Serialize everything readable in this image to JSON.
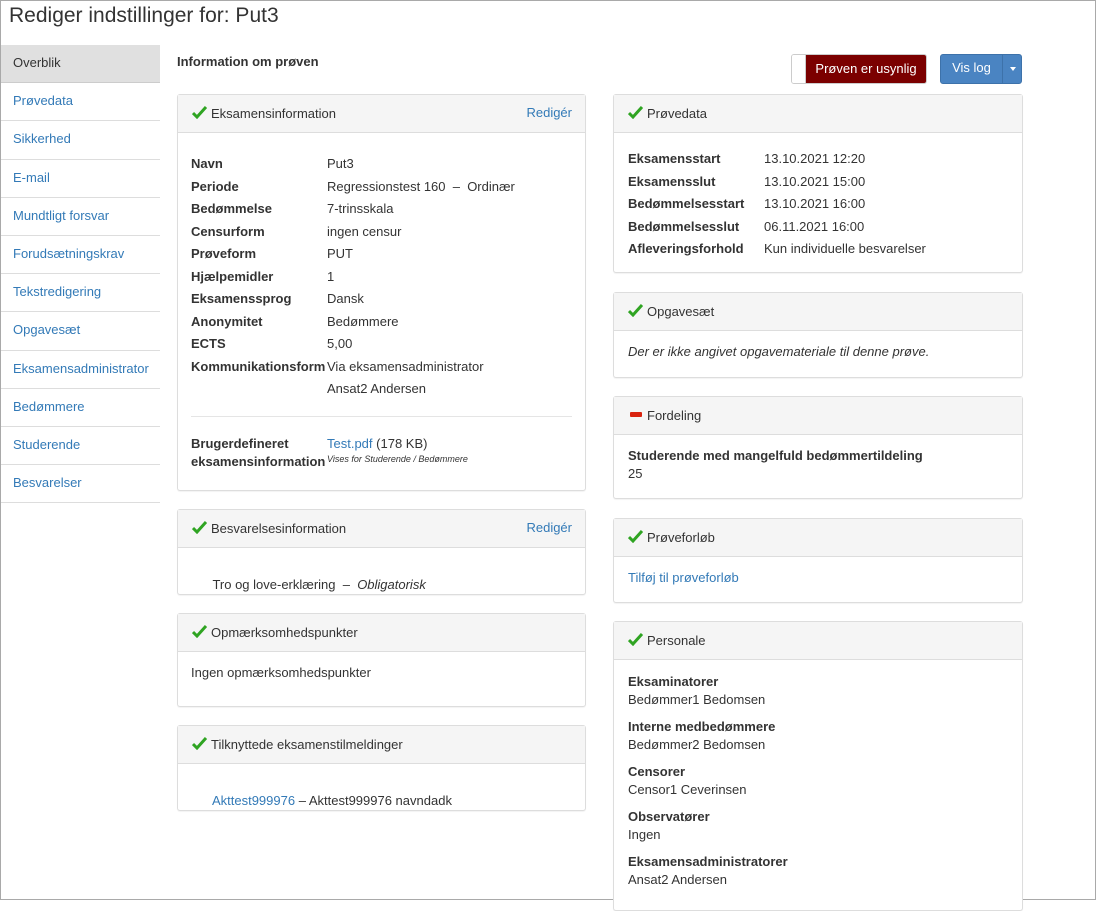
{
  "page": {
    "title": "Rediger indstillinger for: Put3"
  },
  "sidebar": {
    "items": [
      {
        "label": "Overblik",
        "active": true
      },
      {
        "label": "Prøvedata"
      },
      {
        "label": "Sikkerhed"
      },
      {
        "label": "E-mail"
      },
      {
        "label": "Mundtligt forsvar"
      },
      {
        "label": "Forudsætningskrav"
      },
      {
        "label": "Tekstredigering"
      },
      {
        "label": "Opgavesæt"
      },
      {
        "label": "Eksamensadministrator"
      },
      {
        "label": "Bedømmere"
      },
      {
        "label": "Studerende"
      },
      {
        "label": "Besvarelser"
      }
    ]
  },
  "main": {
    "heading": "Information om prøven"
  },
  "toolbar": {
    "unusable_label": "Prøven er usynlig",
    "log_label": "Vis log",
    "colors": {
      "danger": "#7b0000",
      "primary": "#4a84c2"
    }
  },
  "exam_info": {
    "title": "Eksamensinformation",
    "edit": "Redigér",
    "rows": [
      {
        "k": "Navn",
        "v": "Put3"
      },
      {
        "k": "Periode",
        "v": "Regressionstest 160  –  Ordinær"
      },
      {
        "k": "Bedømmelse",
        "v": "7-trinsskala"
      },
      {
        "k": "Censurform",
        "v": "ingen censur"
      },
      {
        "k": "Prøveform",
        "v": "PUT"
      },
      {
        "k": "Hjælpemidler",
        "v": "1"
      },
      {
        "k": "Eksamenssprog",
        "v": "Dansk"
      },
      {
        "k": "Anonymitet",
        "v": "Bedømmere"
      },
      {
        "k": "ECTS",
        "v": "5,00"
      },
      {
        "k": "Kommunikationsform",
        "v": "Via eksamensadministrator"
      }
    ],
    "extra_value": "Ansat2 Andersen",
    "custom_label_1": "Brugerdefineret",
    "custom_label_2": "eksamensinformation",
    "file_link": "Test.pdf",
    "file_size": "(178 KB)",
    "visibility": "Vises for Studerende / Bedømmere"
  },
  "submission_info": {
    "title": "Besvarelsesinformation",
    "edit": "Redigér",
    "text": "Tro og love-erklæring  –  ",
    "required": "Obligatorisk"
  },
  "attention": {
    "title": "Opmærksomhedspunkter",
    "text": "Ingen opmærksomhedspunkter"
  },
  "registrations": {
    "title": "Tilknyttede eksamenstilmeldinger",
    "link": "Akttest999976",
    "text": " – Akttest999976 navndadk"
  },
  "exam_data": {
    "title": "Prøvedata",
    "rows": [
      {
        "k": "Eksamensstart",
        "v": "13.10.2021 12:20"
      },
      {
        "k": "Eksamensslut",
        "v": "13.10.2021 15:00"
      },
      {
        "k": "Bedømmelsesstart",
        "v": "13.10.2021 16:00"
      },
      {
        "k": "Bedømmelsesslut",
        "v": "06.11.2021 16:00"
      },
      {
        "k": "Afleveringsforhold",
        "v": "Kun individuelle besvarelser"
      }
    ]
  },
  "assignments": {
    "title": "Opgavesæt",
    "text": "Der er ikke angivet opgavemateriale til denne prøve."
  },
  "distribution": {
    "title": "Fordeling",
    "label": "Studerende med mangelfuld bedømmertildeling",
    "value": "25"
  },
  "course": {
    "title": "Prøveforløb",
    "link": "Tilføj til prøveforløb"
  },
  "staff": {
    "title": "Personale",
    "groups": [
      {
        "k": "Eksaminatorer",
        "v": "Bedømmer1 Bedomsen"
      },
      {
        "k": "Interne medbedømmere",
        "v": "Bedømmer2 Bedomsen"
      },
      {
        "k": "Censorer",
        "v": "Censor1 Ceverinsen"
      },
      {
        "k": "Observatører",
        "v": "Ingen"
      },
      {
        "k": "Eksamensadministratorer",
        "v": "Ansat2 Andersen"
      }
    ]
  }
}
